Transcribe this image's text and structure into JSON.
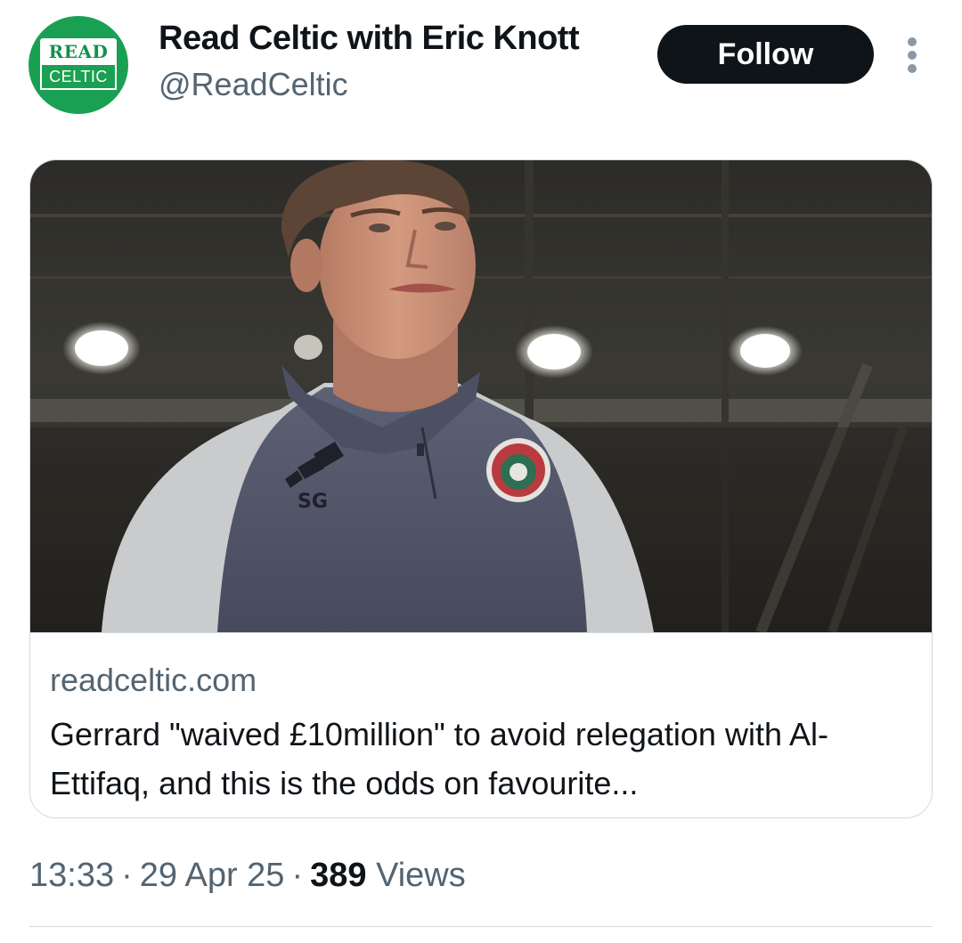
{
  "header": {
    "avatar": {
      "logo_top": "READ",
      "logo_bottom": "CELTIC",
      "background_color": "#1aa053"
    },
    "display_name": "Read Celtic with Eric Knott",
    "handle": "@ReadCeltic",
    "follow_label": "Follow",
    "more_icon": "more-vertical-icon"
  },
  "card": {
    "domain": "readceltic.com",
    "title": "Gerrard \"waived £10million\" to avoid relegation with Al-Ettifaq, and this is the odds on favourite...",
    "image": {
      "jacket_monogram": "SG"
    }
  },
  "meta": {
    "time": "13:33",
    "separator": "·",
    "date": "29 Apr 25",
    "views_count": "389",
    "views_label": "Views"
  }
}
